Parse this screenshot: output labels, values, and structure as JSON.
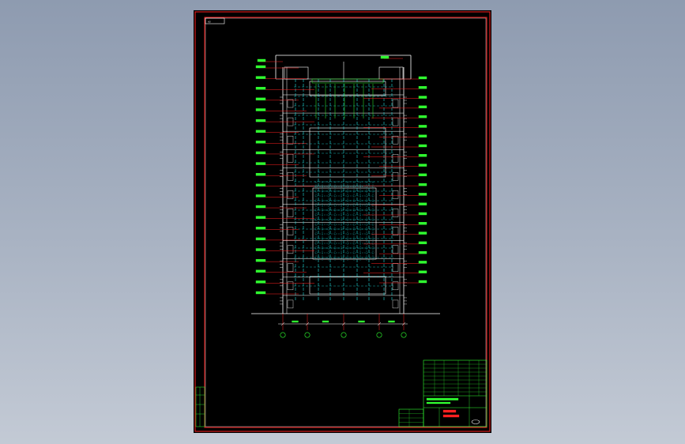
{
  "viewer": {
    "background_colors": [
      "#8e9bb0",
      "#c3cad5"
    ]
  },
  "drawing": {
    "sheet_tag": "A3",
    "colors": {
      "sheet": "#000000",
      "frame": "#ff2020",
      "inner_frame": "#ffffff",
      "structure": "#ffffff",
      "ducts": "#20e0e0",
      "leaders": "#ff2020",
      "labels": "#30ff30",
      "title_block": "#30ff30"
    },
    "axis_markers": [
      "",
      "",
      "",
      "",
      ""
    ],
    "floor_count": 12,
    "left_label_count": 22,
    "right_label_count": 22
  },
  "title_block": {
    "project": "",
    "drawing_title": ""
  }
}
